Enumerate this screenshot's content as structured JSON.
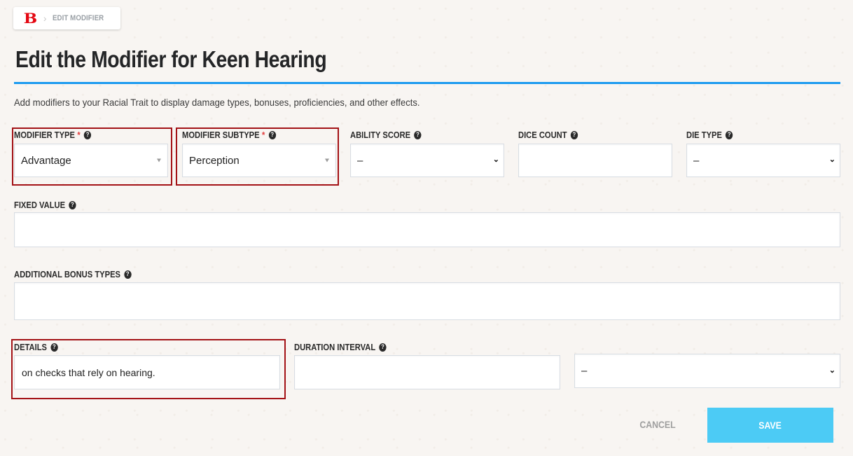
{
  "breadcrumb": {
    "logo": "B",
    "separator": "›",
    "current": "EDIT MODIFIER"
  },
  "page": {
    "title": "Edit the Modifier for Keen Hearing",
    "description": "Add modifiers to your Racial Trait to display damage types, bonuses, proficiencies, and other effects.",
    "accent_color": "#1b9af0",
    "highlight_color": "#a31216"
  },
  "fields": {
    "modifier_type": {
      "label": "MODIFIER TYPE",
      "required": "*",
      "value": "Advantage"
    },
    "modifier_subtype": {
      "label": "MODIFIER SUBTYPE",
      "required": "*",
      "value": "Perception"
    },
    "ability_score": {
      "label": "ABILITY SCORE",
      "value": "–"
    },
    "dice_count": {
      "label": "DICE COUNT",
      "value": ""
    },
    "die_type": {
      "label": "DIE TYPE",
      "value": "–"
    },
    "fixed_value": {
      "label": "FIXED VALUE",
      "value": ""
    },
    "additional_bonus_types": {
      "label": "ADDITIONAL BONUS TYPES",
      "value": ""
    },
    "details": {
      "label": "DETAILS",
      "value": "on checks that rely on hearing."
    },
    "duration_interval": {
      "label": "DURATION INTERVAL",
      "value": ""
    },
    "duration_unit": {
      "value": "–"
    }
  },
  "help_icon": "?",
  "icons": {
    "help": "question-circle-icon",
    "dropdown_small": "caret-down-icon",
    "dropdown": "chevron-down-icon"
  },
  "actions": {
    "cancel": "CANCEL",
    "save": "SAVE",
    "save_color": "#4ccbf5"
  }
}
